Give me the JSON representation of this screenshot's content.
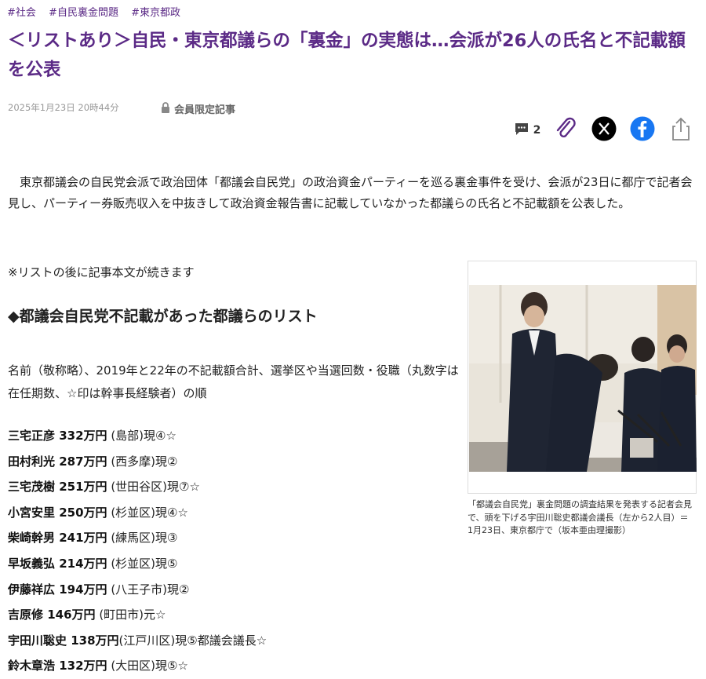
{
  "tags": [
    "#社会",
    "#自民裏金問題",
    "#東京都政"
  ],
  "title": "＜リストあり＞自民・東京都議らの「裏金」の実態は…会派が26人の氏名と不記載額を公表",
  "date": "2025年1月23日 20時44分",
  "members_only": "会員限定記事",
  "comment_count": "2",
  "lead": "東京都議会の自民党会派で政治団体「都議会自民党」の政治資金パーティーを巡る裏金事件を受け、会派が23日に都庁で記者会見し、パーティー券販売収入を中抜きして政治資金報告書に記載していなかった都議らの氏名と不記載額を公表した。",
  "note": "※リストの後に記事本文が続きます",
  "subhead": "◆都議会自民党不記載があった都議らのリスト",
  "order_desc": "名前（敬称略）、2019年と22年の不記載額合計、選挙区や当選回数・役職（丸数字は在任期数、☆印は幹事長経験者）の順",
  "list": [
    {
      "name_amount": "三宅正彦 332万円",
      "detail": " (島部)現④☆"
    },
    {
      "name_amount": "田村利光 287万円",
      "detail": " (西多摩)現②"
    },
    {
      "name_amount": "三宅茂樹 251万円",
      "detail": " (世田谷区)現⑦☆"
    },
    {
      "name_amount": "小宮安里 250万円",
      "detail": " (杉並区)現④☆"
    },
    {
      "name_amount": "柴崎幹男 241万円",
      "detail": " (練馬区)現③"
    },
    {
      "name_amount": "早坂義弘 214万円",
      "detail": " (杉並区)現⑤"
    },
    {
      "name_amount": "伊藤祥広 194万円",
      "detail": " (八王子市)現②"
    },
    {
      "name_amount": "吉原修 146万円",
      "detail": " (町田市)元☆"
    },
    {
      "name_amount": "宇田川聡史 138万円",
      "detail": "(江戸川区)現⑤都議会議長☆"
    },
    {
      "name_amount": "鈴木章浩 132万円",
      "detail": " (大田区)現⑤☆"
    }
  ],
  "caption": "「都議会自民党」裏金問題の調査結果を発表する記者会見で、頭を下げる宇田川聡史都議会議長（左から2人目）＝1月23日、東京都庁で（坂本亜由理撮影）",
  "colors": {
    "accent": "#5b2a86",
    "facebook": "#1877f2",
    "x": "#000000"
  },
  "icons": [
    "lock-icon",
    "comment-icon",
    "clip-icon",
    "x-logo-icon",
    "facebook-icon",
    "share-icon"
  ]
}
